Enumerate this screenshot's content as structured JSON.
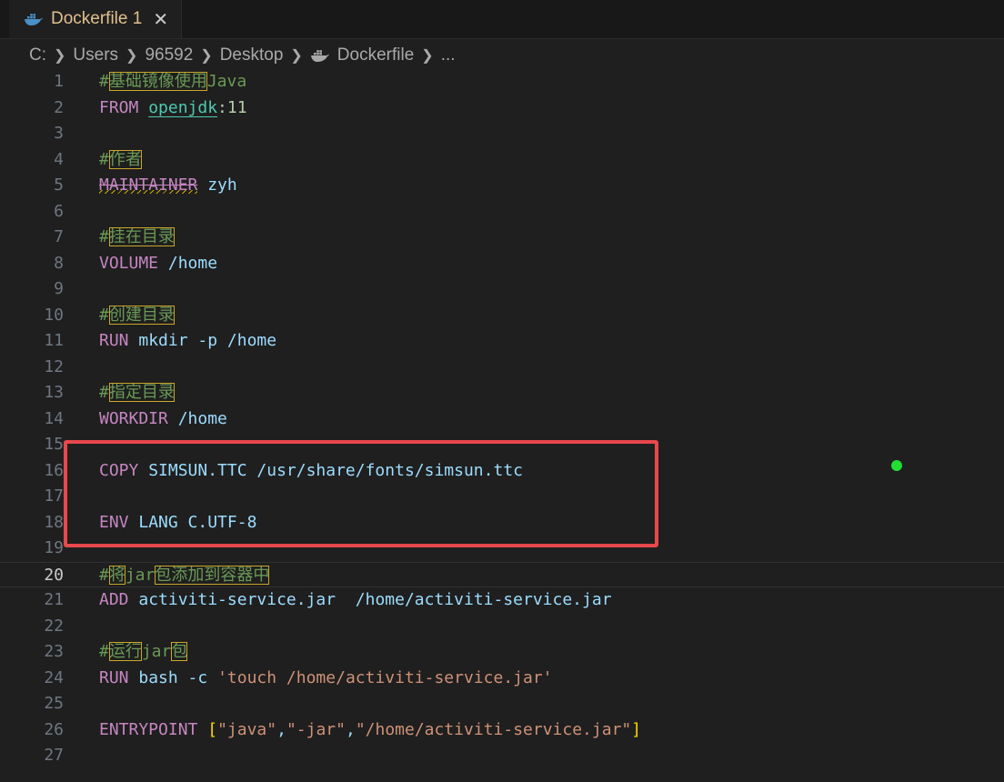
{
  "tab": {
    "icon": "docker-whale-icon",
    "label": "Dockerfile 1",
    "close": "✕"
  },
  "breadcrumb": {
    "items": [
      "C:",
      "Users",
      "96592",
      "Desktop",
      "Dockerfile",
      "..."
    ]
  },
  "editor": {
    "active_line": 20,
    "lines": [
      {
        "n": "1",
        "t": [
          [
            "cm",
            "#"
          ],
          [
            "cjk",
            "基础镜像使用"
          ],
          [
            "cm",
            "Java"
          ]
        ]
      },
      {
        "n": "2",
        "t": [
          [
            "kw",
            "FROM "
          ],
          [
            "img",
            "openjdk"
          ],
          [
            "num",
            ":11"
          ]
        ]
      },
      {
        "n": "3",
        "t": []
      },
      {
        "n": "4",
        "t": [
          [
            "cm",
            "#"
          ],
          [
            "cjk",
            "作者"
          ]
        ]
      },
      {
        "n": "5",
        "t": [
          [
            "dep",
            "MAINTAINER"
          ],
          [
            "arg",
            " zyh"
          ]
        ]
      },
      {
        "n": "6",
        "t": []
      },
      {
        "n": "7",
        "t": [
          [
            "cm",
            "#"
          ],
          [
            "cjk",
            "挂在目录"
          ]
        ]
      },
      {
        "n": "8",
        "t": [
          [
            "kw",
            "VOLUME "
          ],
          [
            "arg",
            "/home"
          ]
        ]
      },
      {
        "n": "9",
        "t": []
      },
      {
        "n": "10",
        "t": [
          [
            "cm",
            "#"
          ],
          [
            "cjk",
            "创建目录"
          ]
        ]
      },
      {
        "n": "11",
        "t": [
          [
            "kw",
            "RUN "
          ],
          [
            "arg",
            "mkdir -p /home"
          ]
        ]
      },
      {
        "n": "12",
        "t": []
      },
      {
        "n": "13",
        "t": [
          [
            "cm",
            "#"
          ],
          [
            "cjk",
            "指定目录"
          ]
        ]
      },
      {
        "n": "14",
        "t": [
          [
            "kw",
            "WORKDIR "
          ],
          [
            "arg",
            "/home"
          ]
        ]
      },
      {
        "n": "15",
        "t": []
      },
      {
        "n": "16",
        "t": [
          [
            "kw",
            "COPY "
          ],
          [
            "arg",
            "SIMSUN.TTC /usr/share/fonts/simsun.ttc"
          ]
        ]
      },
      {
        "n": "17",
        "t": []
      },
      {
        "n": "18",
        "t": [
          [
            "kw",
            "ENV "
          ],
          [
            "arg",
            "LANG C.UTF-8"
          ]
        ]
      },
      {
        "n": "19",
        "t": []
      },
      {
        "n": "20",
        "t": [
          [
            "cm",
            "#"
          ],
          [
            "cjk",
            "将"
          ],
          [
            "cm",
            "jar"
          ],
          [
            "cjk",
            "包添加到容器中"
          ]
        ]
      },
      {
        "n": "21",
        "t": [
          [
            "kw",
            "ADD "
          ],
          [
            "arg",
            "activiti-service.jar  /home/activiti-service.jar"
          ]
        ]
      },
      {
        "n": "22",
        "t": []
      },
      {
        "n": "23",
        "t": [
          [
            "cm",
            "#"
          ],
          [
            "cjk",
            "运行"
          ],
          [
            "cm",
            "jar"
          ],
          [
            "cjk",
            "包"
          ]
        ]
      },
      {
        "n": "24",
        "t": [
          [
            "kw",
            "RUN "
          ],
          [
            "arg",
            "bash -c "
          ],
          [
            "str",
            "'touch /home/activiti-service.jar'"
          ]
        ]
      },
      {
        "n": "25",
        "t": []
      },
      {
        "n": "26",
        "t": [
          [
            "kw",
            "ENTRYPOINT "
          ],
          [
            "brk",
            "["
          ],
          [
            "str",
            "\"java\""
          ],
          [
            "arg",
            ","
          ],
          [
            "str",
            "\"-jar\""
          ],
          [
            "arg",
            ","
          ],
          [
            "str",
            "\"/home/activiti-service.jar\""
          ],
          [
            "brk",
            "]"
          ]
        ]
      },
      {
        "n": "27",
        "t": []
      }
    ]
  },
  "colors": {
    "background": "#1f1f1f",
    "keyword": "#c586c0",
    "comment": "#6a9955",
    "string": "#ce9178",
    "highlight_box": "#e8484c",
    "indicator_dot": "#22dd33"
  }
}
